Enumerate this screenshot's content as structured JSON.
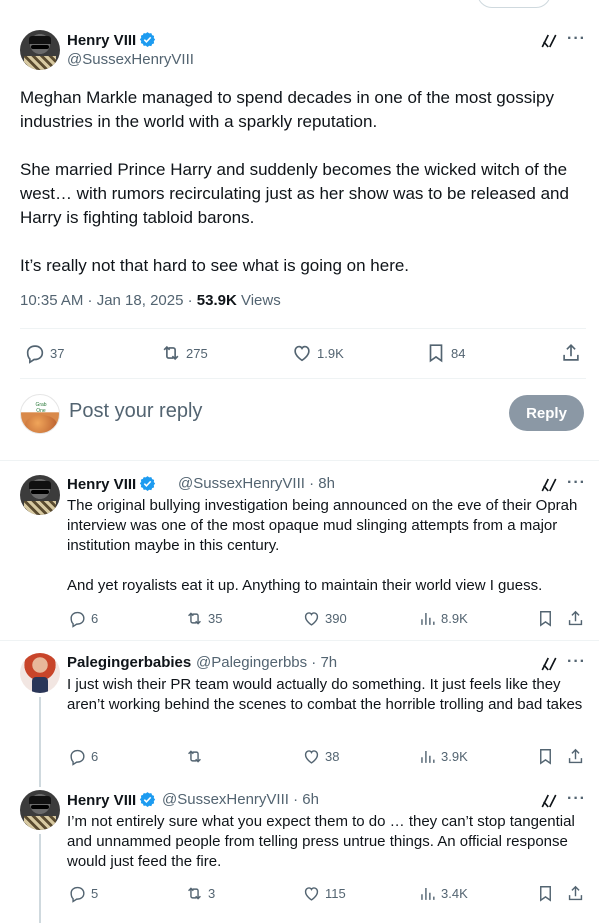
{
  "main_tweet": {
    "name": "Henry VIII",
    "handle": "@SussexHenryVIII",
    "paragraphs": [
      "Meghan Markle managed to spend decades in one of the most gossipy industries in the world with a sparkly reputation.",
      "She married Prince Harry and suddenly becomes the wicked witch of the west… with rumors recirculating just as her show was to be released and Harry is fighting tabloid barons.",
      "It’s really not that hard to see what is going on here."
    ],
    "timestamp": "10:35 AM · Jan 18, 2025 · ",
    "views": "53.9K",
    "views_label": " Views",
    "replies": "37",
    "retweets": "275",
    "likes": "1.9K",
    "bookmarks": "84"
  },
  "reply_box": {
    "placeholder": "Post your reply",
    "button": "Reply",
    "avatar_text": "Grab One"
  },
  "replies": [
    {
      "name": "Henry VIII",
      "handle": "@SussexHenryVIII · 8h",
      "text": "The original bullying investigation being announced on the eve of their Oprah interview was one of the most opaque mud slinging attempts from a major institution maybe in this century.",
      "text2": "And yet royalists eat it up. Anything to maintain their world view I guess.",
      "replies": "6",
      "retweets": "35",
      "likes": "390",
      "views": "8.9K"
    },
    {
      "name": "Palegingerbabies",
      "handle": "@Palegingerbbs · 7h",
      "text": "I just wish their PR team would actually do something. It just feels like they aren’t working behind the scenes to combat the horrible trolling and bad takes",
      "replies": "6",
      "retweets": "",
      "likes": "38",
      "views": "3.9K"
    },
    {
      "name": "Henry VIII",
      "handle": "@SussexHenryVIII · 6h",
      "text": "I’m not entirely sure what you expect them to do … they can’t stop tangential and unnammed people from telling press untrue things. An official response would just feed the fire.",
      "replies": "5",
      "retweets": "3",
      "likes": "115",
      "views": "3.4K"
    }
  ],
  "colors": {
    "accent": "#1d9bf0",
    "reply_button": "#8b98a5",
    "text": "#0f1419",
    "secondary": "#536471"
  }
}
